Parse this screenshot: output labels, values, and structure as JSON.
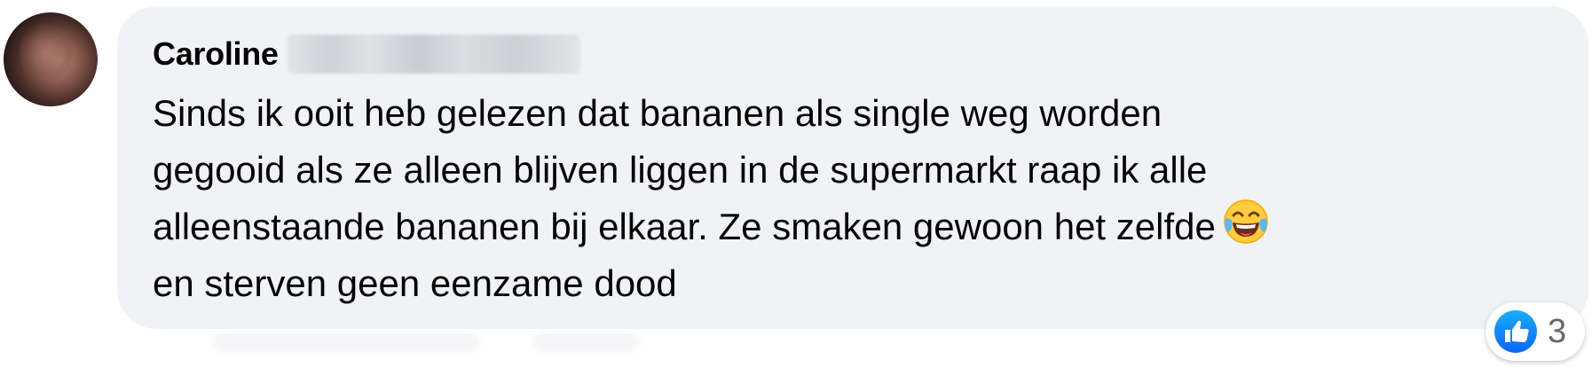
{
  "comment": {
    "author_name": "Caroline",
    "text": "Sinds ik ooit heb gelezen dat bananen als single weg worden\ngegooid als ze alleen blijven liggen in de supermarkt raap ik alle\nalleenstaande bananen bij elkaar. Ze smaken gewoon het zelfde",
    "text_after_emoji": "\nen sterven geen eenzame dood",
    "emoji": "face-with-tears-of-joy-icon",
    "reaction": {
      "icon": "like-icon",
      "count": "3"
    }
  },
  "colors": {
    "bubble_bg": "#f0f2f5",
    "text": "#050505",
    "like_blue": "#1877f2",
    "count_gray": "#65676b"
  }
}
